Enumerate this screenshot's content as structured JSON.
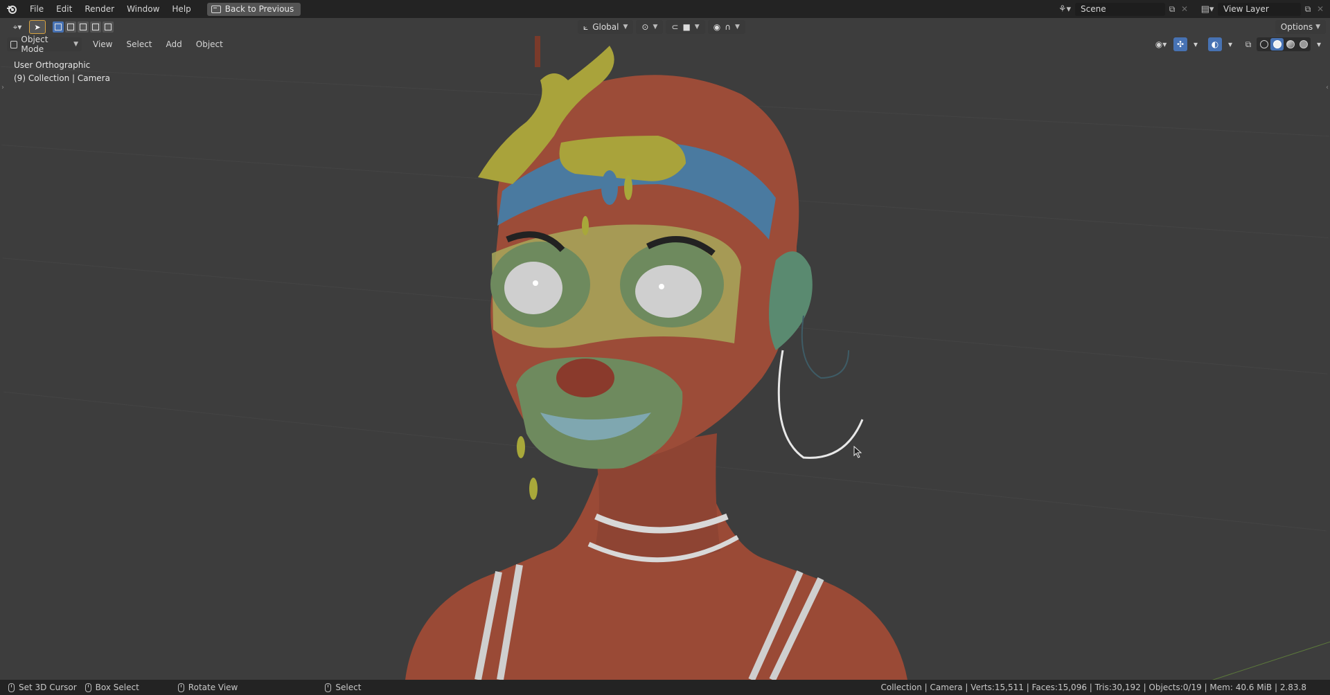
{
  "app": {
    "menus": [
      "File",
      "Edit",
      "Render",
      "Window",
      "Help"
    ],
    "back_button": "Back to Previous",
    "scene": "Scene",
    "view_layer": "View Layer"
  },
  "viewport_header": {
    "transform_orientation": "Global",
    "options_label": "Options",
    "mode": "Object Mode",
    "menus": [
      "View",
      "Select",
      "Add",
      "Object"
    ],
    "shading_modes": [
      "wireframe",
      "solid",
      "material-preview",
      "rendered"
    ],
    "active_shading": "solid"
  },
  "viewport": {
    "view_name": "User Orthographic",
    "collection_info": "(9) Collection | Camera"
  },
  "statusbar": {
    "items": [
      "Set 3D Cursor",
      "Box Select",
      "Rotate View",
      "Select"
    ],
    "stats": "Collection | Camera | Verts:15,511 | Faces:15,096 | Tris:30,192 | Objects:0/19 | Mem: 40.6 MiB | 2.83.8"
  },
  "colors": {
    "skin": "#9c4c38",
    "paint_green": "#6e8a5e",
    "paint_blue": "#4a7aa0",
    "paint_yellow": "#a8a85a",
    "accent_blue": "#4772b3",
    "active_tool_outline": "#d9a441"
  }
}
